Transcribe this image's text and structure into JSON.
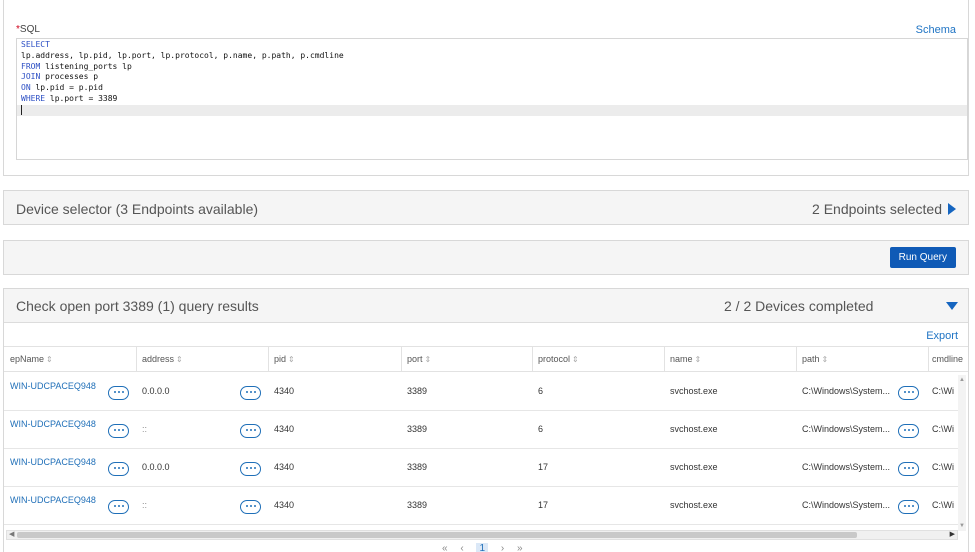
{
  "sql": {
    "label_required": "*",
    "label": "SQL",
    "schema_link": "Schema",
    "lines": [
      {
        "kw": "SELECT",
        "rest": ""
      },
      {
        "kw": "",
        "rest": "lp.address, lp.pid, lp.port, lp.protocol, p.name, p.path, p.cmdline"
      },
      {
        "kw": "FROM",
        "rest": " listening_ports lp"
      },
      {
        "kw": "JOIN",
        "rest": " processes p"
      },
      {
        "kw": "ON",
        "rest": " lp.pid = p.pid"
      },
      {
        "kw": "WHERE",
        "rest": " lp.port = 3389"
      }
    ]
  },
  "device_selector": {
    "label": "Device selector (3 Endpoints available)",
    "selected": "2 Endpoints selected"
  },
  "run_query": {
    "label": "Run Query"
  },
  "results": {
    "title": "Check open port 3389 (1) query results",
    "status": "2 / 2 Devices completed",
    "export": "Export",
    "columns": [
      "epName",
      "address",
      "pid",
      "port",
      "protocol",
      "name",
      "path",
      "cmdline"
    ],
    "sort_icon": "sort-icon",
    "rows": [
      {
        "epName": "WIN-UDCPACEQ948",
        "address": "0.0.0.0",
        "pid": "4340",
        "port": "3389",
        "protocol": "6",
        "name": "svchost.exe",
        "path": "C:\\Windows\\System...",
        "cmdline": "C:\\Wi"
      },
      {
        "epName": "WIN-UDCPACEQ948",
        "address": "::",
        "pid": "4340",
        "port": "3389",
        "protocol": "6",
        "name": "svchost.exe",
        "path": "C:\\Windows\\System...",
        "cmdline": "C:\\Wi"
      },
      {
        "epName": "WIN-UDCPACEQ948",
        "address": "0.0.0.0",
        "pid": "4340",
        "port": "3389",
        "protocol": "17",
        "name": "svchost.exe",
        "path": "C:\\Windows\\System...",
        "cmdline": "C:\\Wi"
      },
      {
        "epName": "WIN-UDCPACEQ948",
        "address": "::",
        "pid": "4340",
        "port": "3389",
        "protocol": "17",
        "name": "svchost.exe",
        "path": "C:\\Windows\\System...",
        "cmdline": "C:\\Wi"
      }
    ]
  },
  "pager": {
    "first": "«",
    "prev": "‹",
    "current": "1",
    "next": "›",
    "last": "»"
  },
  "colors": {
    "accent": "#0f5ab6",
    "link": "#1f74c4",
    "keyword": "#2c4fc4"
  }
}
